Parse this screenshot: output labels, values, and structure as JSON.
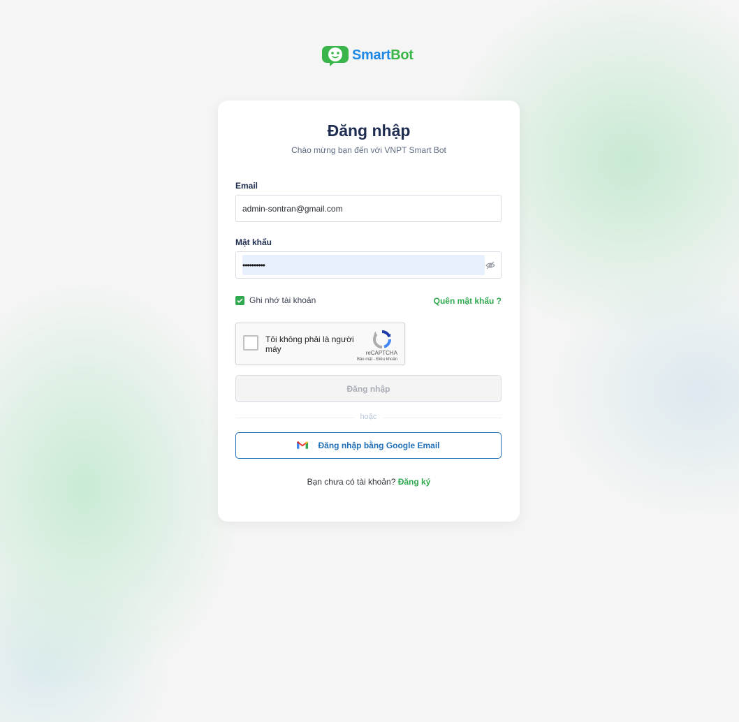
{
  "brand": {
    "name_part1": "Smart",
    "name_part2": "Bot",
    "logo_icon": "bot-face-icon",
    "primary_color": "#1e88e5",
    "accent_color": "#3ab54a"
  },
  "login": {
    "title": "Đăng nhập",
    "subtitle": "Chào mừng bạn đến với VNPT Smart Bot",
    "email_label": "Email",
    "email_value": "admin-sontran@gmail.com",
    "password_label": "Mật khẩu",
    "password_value": "••••••••••",
    "password_toggle_icon": "eye-off-icon",
    "remember_label": "Ghi nhớ tài khoản",
    "remember_checked": true,
    "forgot_link": "Quên mật khẩu ?",
    "submit_label": "Đăng nhập",
    "divider_text": "hoặc",
    "google_label": "Đăng nhập bằng Google Email",
    "google_icon": "gmail-icon",
    "signup_prompt": "Bạn chưa có tài khoản?",
    "signup_link": "Đăng ký"
  },
  "recaptcha": {
    "label": "Tôi không phải là người máy",
    "brand": "reCAPTCHA",
    "links": "Bảo mật - Điều khoản"
  }
}
